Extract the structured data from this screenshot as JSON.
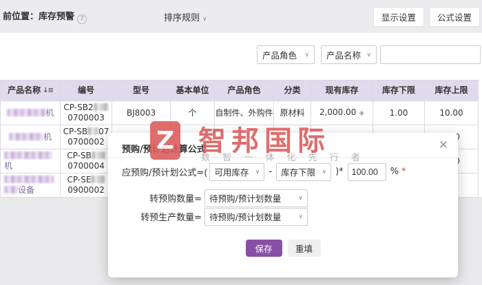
{
  "topbar": {
    "location_label": "前位置：",
    "location_value": "库存预警",
    "help_icon": "?",
    "sort_label": "排序规则",
    "chevron": "∨",
    "display_settings_btn": "显示设置",
    "formula_settings_btn": "公式设置"
  },
  "filters": {
    "role_select_value": "产品角色",
    "name_select_value": "产品名称",
    "search_value": ""
  },
  "table": {
    "columns": {
      "name": "产品名称",
      "code": "编号",
      "model": "型号",
      "unit": "基本单位",
      "role": "产品角色",
      "category": "分类",
      "stock": "现有库存",
      "lower": "库存下限",
      "upper": "库存上限"
    },
    "sort_icon": "↓≡",
    "diamond_icon": "◈",
    "rows": [
      {
        "name_suffix": "机",
        "code_line1_prefix": "CP-SB2",
        "code_line2": "0700003",
        "model": "BJ8003",
        "unit": "个",
        "role": "自制件、外购件",
        "category": "原材料",
        "stock": "2,000.00",
        "lower": "1.00",
        "upper": "10.00"
      },
      {
        "name_suffix": "机",
        "code_line1_prefix": "CP-SB",
        "code_line1_tail": "07",
        "code_line2": "0700002",
        "upper_fragment": "0"
      },
      {
        "name_suffix": "机",
        "code_line1_prefix": "CP-SB",
        "code_line2": "0700004",
        "upper_fragment": "0"
      },
      {
        "name_suffix": "设备",
        "code_line1_prefix": "CP-SE",
        "code_line2": "0900002"
      }
    ]
  },
  "modal": {
    "title": "预购/预计划计算公式",
    "close_icon": "✕",
    "formula_label": "应预购/预计划公式=(",
    "minuend_value": "可用库存",
    "operator": "-",
    "subtrahend_value": "库存下限",
    "close_paren": ")*",
    "percent_value": "100.00",
    "percent_sign": "%",
    "required_mark": "*",
    "chevron": "∨",
    "to_prepurchase_label": "转预购数量=",
    "to_prepurchase_value": "待预购/预计划数量",
    "to_preproduction_label": "转预生产数量=",
    "to_preproduction_value": "待预购/预计划数量",
    "save_btn": "保存",
    "reset_btn": "重填"
  },
  "watermark": {
    "logo_letter": "Z",
    "brand": "智邦国际",
    "slogan": "数 智 一 体 化 先 行 者",
    "brand_color": "#db5a5a"
  }
}
